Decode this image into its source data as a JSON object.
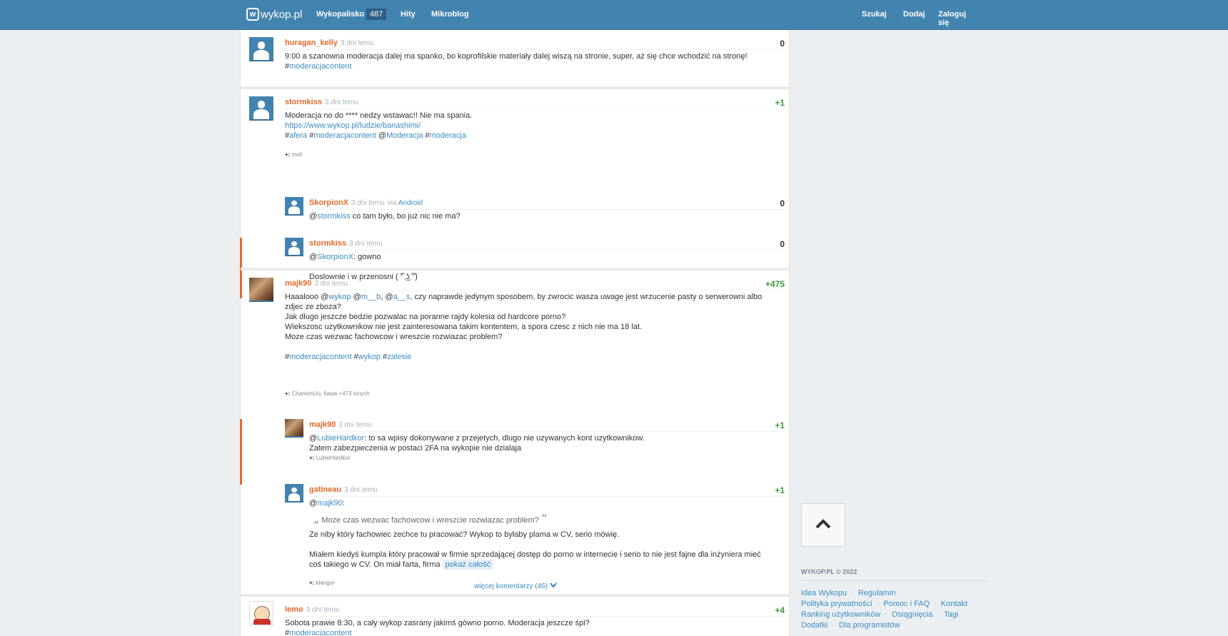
{
  "header": {
    "logo_text": "wykop.pl",
    "logo_mark": "w",
    "nav": {
      "wykopalisko": "Wykopalisko",
      "wykopalisko_count": "487",
      "hity": "Hity",
      "mikroblog": "Mikroblog"
    },
    "right": {
      "szukaj": "Szukaj",
      "dodaj": "Dodaj",
      "zaloguj": "Zaloguj się"
    }
  },
  "entries": {
    "e1": {
      "author": "huragan_kelly",
      "date": "3 dni temu",
      "score": "0",
      "text": "9:00 a szanowna moderacja dalej ma spanko, bo koprofilskie materiały dalej wiszą na stronie, super, aż się chce wchodzić na stronę!",
      "tag_hash": "#",
      "tag": "moderacjacontent"
    },
    "e2": {
      "author": "stormkiss",
      "date": "3 dni temu",
      "score": "+1",
      "line1": "Moderacja no do **** nedzy wstawac!! Nie ma spania.",
      "link": "https://www.wykop.pl/ludzie/banashimi/",
      "tags": {
        "h1": "#",
        "t1": "afera",
        "h2": " #",
        "t2": "moderacjacontent",
        "h3": " @",
        "t3": "Moderacja",
        "h4": " #",
        "t4": "moderacja"
      },
      "voters_prefix": "+:",
      "voters": "moli",
      "comments": {
        "c1": {
          "author": "SkorpionX",
          "date": "3 dni temu",
          "via_prefix": "via",
          "via": "Android",
          "score": "0",
          "at": "@",
          "mention": "stormkiss",
          "text": " co tam było, bo już nic nie ma?"
        },
        "c2": {
          "author": "stormkiss",
          "date": "3 dni temu",
          "score": "0",
          "at": "@",
          "mention": "SkorpionX",
          "text": ": gowno",
          "line2": "Doslownie i w przenosni ( ͡° ͜ʖ ͡°)"
        }
      }
    },
    "e3": {
      "author": "majk90",
      "date": "3 dni temu",
      "score": "+475",
      "l1": {
        "a1": "Haaalooo @",
        "m1": "wykop",
        "a2": " @",
        "m2": "m__b",
        "a3": ", @",
        "m3": "a__s",
        "rest": ", czy naprawde jedynym sposobem, by zwrocic wasza uwage jest wrzucenie pasty o serwerowni albo"
      },
      "l2": "zdjec ze zboza?",
      "l3": "Jak dlugo jeszcze bedzie pozwalac na poranne rajdy kolesia od hardcore porno?",
      "l4": "Wiekszosc uzytkownikow nie jest zainteresowana takim kontentem, a spora czesc z nich nie ma 18 lat.",
      "l5": "Moze czas wezwac fachowcow i wreszcie rozwiazac problem?",
      "tags": {
        "h1": "#",
        "t1": "moderacjacontent",
        "h2": " #",
        "t2": "wykop",
        "h3": " #",
        "t3": "zalesie"
      },
      "voters_prefix": "+:",
      "voters": "ChareimUu, Ilawa",
      "voters_more": "+473 innych",
      "comments": {
        "c1": {
          "author": "majk90",
          "date": "3 dni temu",
          "score": "+1",
          "at": "@",
          "mention": "LubieHardkor",
          "text": ": to sa wpisy dokonywane z przejetych, dlugo nie uzywanych kont uzytkownikow.",
          "line2": "Zatem zabezpieczenia w postaci 2FA na wykopie nie dzialaja",
          "voters_prefix": "+:",
          "voters": "LubieHardkor"
        },
        "c2": {
          "author": "gatineau",
          "date": "3 dni temu",
          "score": "+1",
          "at": "@",
          "mention": "majk90",
          "colon": ":",
          "quote_open": "„",
          "quote": "Moze czas wezwac fachowcow i wreszcie rozwiazac problem?",
          "quote_close": "”",
          "p1": "Ze niby który fachowiec zechce tu pracować? Wykop to byłaby plama w CV, serio mówię.",
          "p2": "Miałem kiedyś kumpla który pracował w firmie sprzedającej dostęp do porno w internecie i serio to nie jest fajne dla inżyniera mieć",
          "p3": "coś takiego w CV. On miał farta, firma",
          "show_all": "pokaż całość",
          "voters_prefix": "+:",
          "voters": "klangor"
        }
      },
      "more_comments": "więcej komentarzy (46)"
    },
    "e4": {
      "author": "lemo",
      "date": "3 dni temu",
      "score": "+4",
      "text": "Sobota prawie 8:30, a cały wykop zasrany jakimś gówno porno. Moderacja jeszcze śpi?",
      "tag_hash": "#",
      "tag": "moderacjacontent"
    }
  },
  "sidebar": {
    "up_icon": "chevron-up-icon",
    "copyright": "WYKOP.PL © 2022",
    "links": [
      "Idea Wykopu",
      "Regulamin",
      "Polityka prywatności",
      "Pomoc i FAQ",
      "Kontakt",
      "Ranking użytkowników",
      "Osiągnięcia",
      "Tagi",
      "Dodatki",
      "Dla programistów"
    ]
  },
  "colors": {
    "nav_bg": "#4383af",
    "author": "#e3692a",
    "link": "#3b8dc3",
    "positive_score": "#3c9a3c",
    "page_bg": "#eceff1"
  }
}
